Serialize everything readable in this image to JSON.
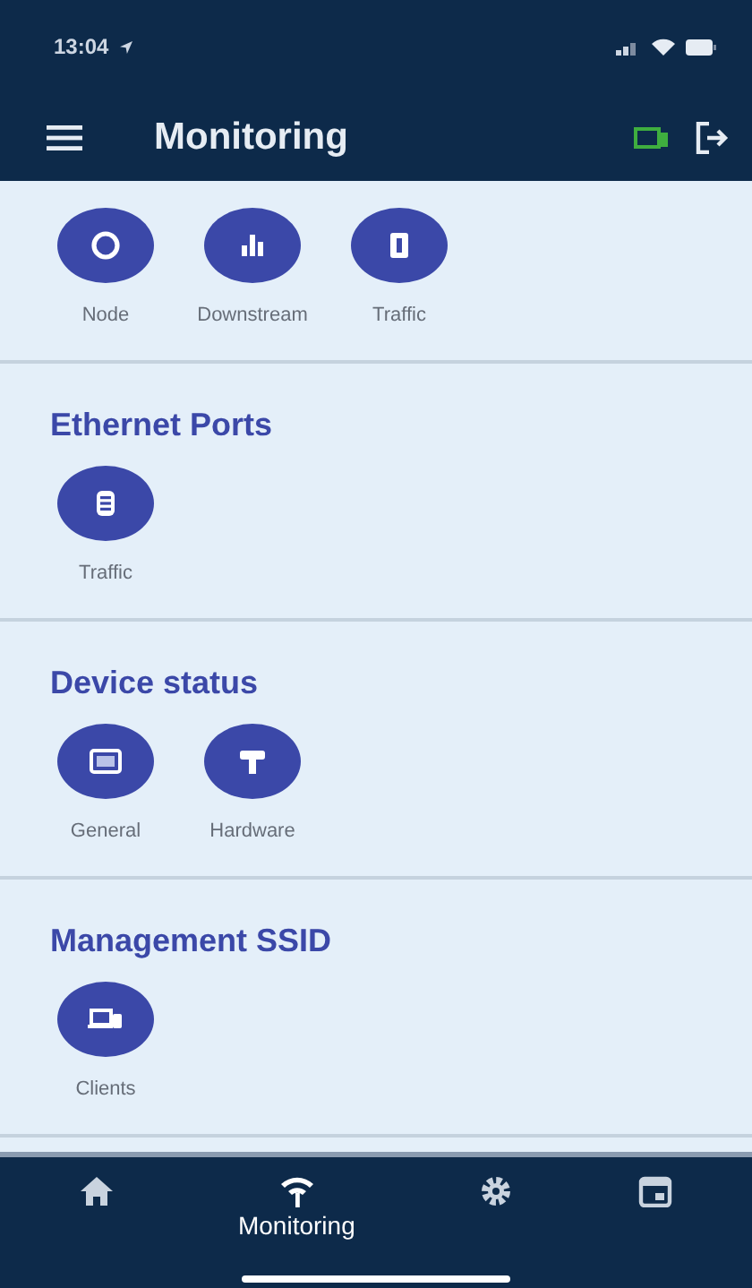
{
  "status_bar": {
    "time": "13:04"
  },
  "header": {
    "title": "Monitoring"
  },
  "sections": [
    {
      "items": [
        {
          "kind": "ring",
          "label": "Node"
        },
        {
          "kind": "bars",
          "label": "Downstream"
        },
        {
          "kind": "port",
          "label": "Traffic"
        }
      ]
    },
    {
      "title": "Ethernet Ports",
      "items": [
        {
          "kind": "stack",
          "label": "Traffic"
        }
      ]
    },
    {
      "title": "Device status",
      "items": [
        {
          "kind": "monitor",
          "label": "General"
        },
        {
          "kind": "hammer",
          "label": "Hardware"
        }
      ]
    },
    {
      "title": "Management SSID",
      "items": [
        {
          "kind": "devices",
          "label": "Clients"
        }
      ]
    }
  ],
  "tab_bar": [
    {
      "kind": "home",
      "selected": false
    },
    {
      "kind": "wifi",
      "label": "Monitoring",
      "selected": true
    },
    {
      "kind": "gear",
      "selected": false
    },
    {
      "kind": "calendar",
      "selected": false
    }
  ]
}
